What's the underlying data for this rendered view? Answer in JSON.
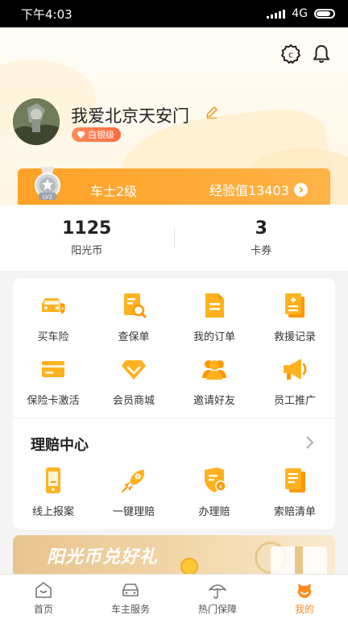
{
  "status_bar": {
    "time": "下午4:03",
    "network": "4G"
  },
  "profile": {
    "username": "我爱北京天安门",
    "level_badge": "白银级"
  },
  "level_bar": {
    "title": "车士2级",
    "experience": "经验值13403",
    "medal_text": "LV2"
  },
  "stats": [
    {
      "value": "1125",
      "label": "阳光币"
    },
    {
      "value": "3",
      "label": "卡券"
    }
  ],
  "services": {
    "row1": [
      {
        "label": "买车险",
        "icon": "car-insurance-icon"
      },
      {
        "label": "查保单",
        "icon": "policy-search-icon"
      },
      {
        "label": "我的订单",
        "icon": "order-document-icon"
      },
      {
        "label": "救援记录",
        "icon": "rescue-record-icon"
      }
    ],
    "row2": [
      {
        "label": "保险卡激活",
        "icon": "card-icon"
      },
      {
        "label": "会员商城",
        "icon": "diamond-icon"
      },
      {
        "label": "邀请好友",
        "icon": "friends-icon"
      },
      {
        "label": "员工推广",
        "icon": "megaphone-icon"
      }
    ]
  },
  "claims": {
    "title": "理赔中心",
    "items": [
      {
        "label": "线上报案",
        "icon": "phone-icon"
      },
      {
        "label": "一键理赔",
        "icon": "rocket-icon"
      },
      {
        "label": "办理赔",
        "icon": "shield-coin-icon"
      },
      {
        "label": "索赔清单",
        "icon": "checklist-icon"
      }
    ]
  },
  "banner": {
    "title": "阳光币兑好礼"
  },
  "tabbar": [
    {
      "label": "首页",
      "active": false
    },
    {
      "label": "车主服务",
      "active": false
    },
    {
      "label": "热门保障",
      "active": false
    },
    {
      "label": "我的",
      "active": true
    }
  ],
  "colors": {
    "accent": "#FFA126",
    "badge": "#FF6A3D",
    "icon_yellow": "#FFB21E"
  }
}
